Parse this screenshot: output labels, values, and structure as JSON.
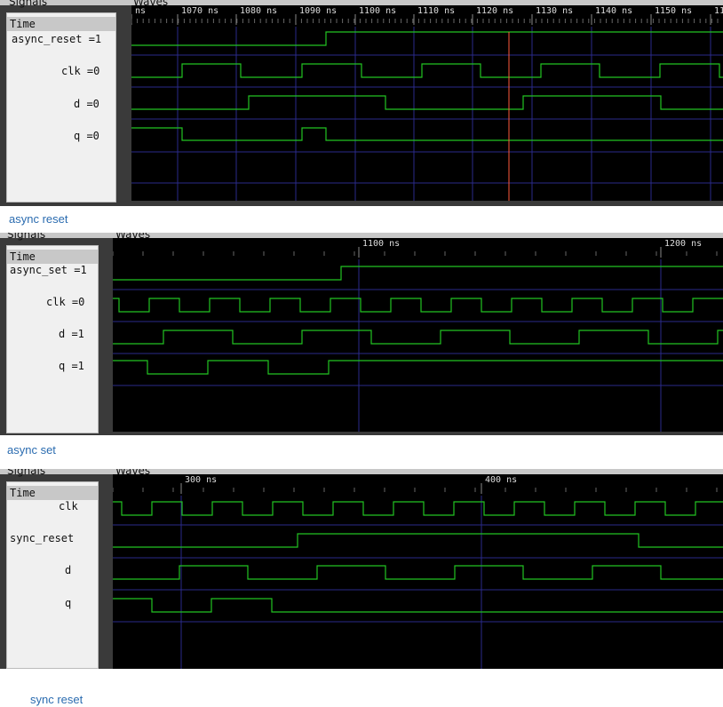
{
  "panels": [
    {
      "signals_header": "Signals",
      "waves_header": "Waves",
      "time_label": "Time",
      "signals": [
        "async_reset =1",
        "clk =0",
        "d =0",
        "q =0"
      ],
      "ticks": [
        "ns",
        "1070 ns",
        "1080 ns",
        "1090 ns",
        "1100 ns",
        "1110 ns",
        "1120 ns",
        "1130 ns",
        "1140 ns",
        "1150 ns",
        "1160 n"
      ],
      "caption": "async reset"
    },
    {
      "signals_header": "Signals",
      "waves_header": "Waves",
      "time_label": "Time",
      "signals": [
        "async_set =1",
        "clk =0",
        "d =1",
        "q =1"
      ],
      "ticks": [
        "1100 ns",
        "1200 ns"
      ],
      "caption": "async set"
    },
    {
      "signals_header": "Signals",
      "waves_header": "Waves",
      "time_label": "Time",
      "signals": [
        "clk",
        "sync_reset",
        "d",
        "q"
      ],
      "ticks": [
        "300 ns",
        "400 ns"
      ],
      "caption": "sync reset"
    }
  ],
  "colors": {
    "wave": "#22c322",
    "grid": "#2a2a8a",
    "cursor": "#ff5a3c",
    "caption": "#2b6cb0"
  }
}
